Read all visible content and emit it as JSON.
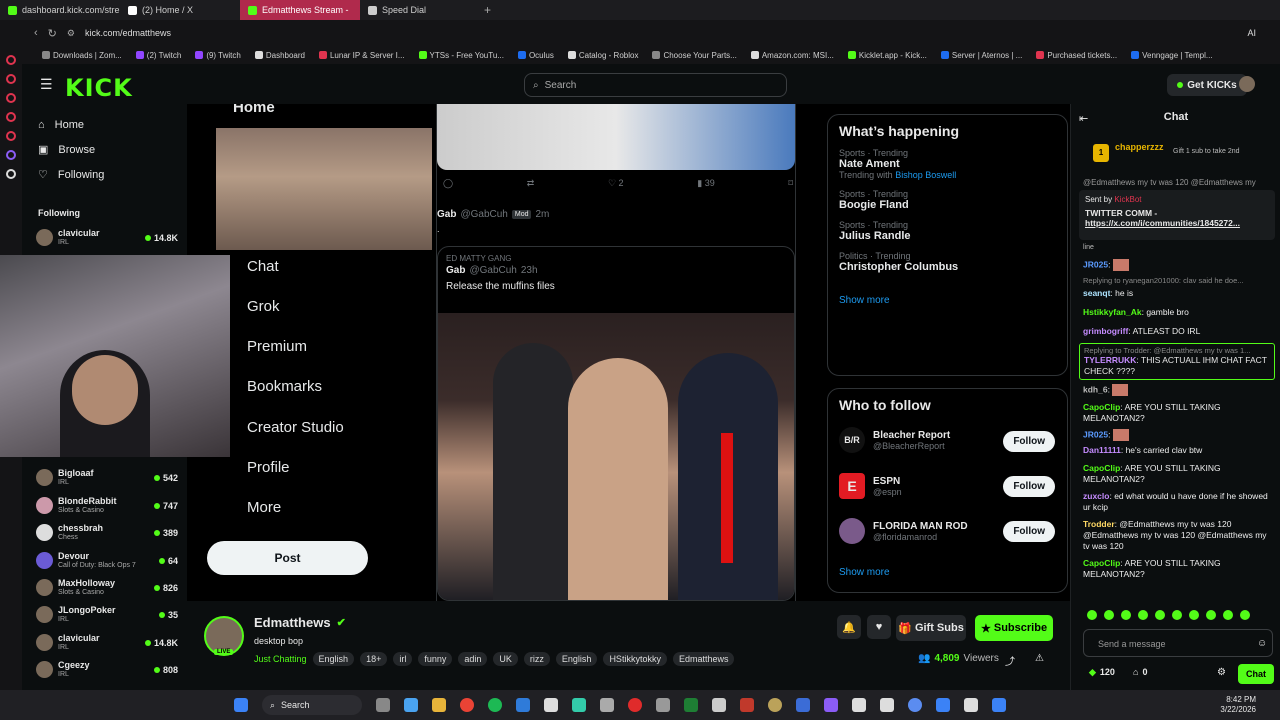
{
  "browser": {
    "tabs": [
      {
        "label": "dashboard.kick.com/stre",
        "color": "#53fc18",
        "active": false
      },
      {
        "label": "(2) Home / X",
        "color": "#ffffff",
        "active": false
      },
      {
        "label": "Edmatthews Stream -",
        "color": "#53fc18",
        "active": true
      },
      {
        "label": "Speed Dial",
        "color": "#cccccc",
        "active": false
      }
    ],
    "url": "kick.com/edmatthews",
    "bookmarks": [
      "Downloads | Zom...",
      "(2) Twitch",
      "(9) Twitch",
      "Dashboard",
      "Lunar IP & Server I...",
      "YTSs - Free YouTu...",
      "Oculus",
      "Catalog - Roblox",
      "Choose Your Parts...",
      "Amazon.com: MSI...",
      "Kicklet.app - Kick...",
      "Server | Aternos | ...",
      "Purchased tickets...",
      "Venngage | Templ..."
    ],
    "ai_label": "AI"
  },
  "header": {
    "logo": "KICK",
    "search_placeholder": "Search",
    "get_kicks": "Get KICKs"
  },
  "sidebar": {
    "nav": [
      {
        "label": "Home",
        "icon": "home-icon"
      },
      {
        "label": "Browse",
        "icon": "browse-icon"
      },
      {
        "label": "Following",
        "icon": "heart-icon"
      }
    ],
    "following_title": "Following",
    "following": [
      {
        "name": "clavicular",
        "category": "IRL",
        "count": "14.8K"
      },
      {
        "name": "Bigloaaf",
        "category": "IRL",
        "count": "542"
      },
      {
        "name": "BlondeRabbit",
        "category": "Slots & Casino",
        "count": "747"
      },
      {
        "name": "chessbrah",
        "category": "Chess",
        "count": "389"
      },
      {
        "name": "Devour",
        "category": "Call of Duty: Black Ops 7",
        "count": "64"
      },
      {
        "name": "MaxHolloway",
        "category": "Slots & Casino",
        "count": "826"
      },
      {
        "name": "JLongoPoker",
        "category": "IRL",
        "count": "35"
      },
      {
        "name": "clavicular",
        "category": "IRL",
        "count": "14.8K"
      },
      {
        "name": "Cgeezy",
        "category": "IRL",
        "count": "808"
      }
    ]
  },
  "stream_content": {
    "x_nav": [
      "Home",
      "Chat",
      "Grok",
      "Premium",
      "Bookmarks",
      "Creator Studio",
      "Profile",
      "More"
    ],
    "post_button": "Post",
    "tweet_stats": {
      "likes": "2",
      "views": "39"
    },
    "tweet": {
      "author": "Gab",
      "handle": "@GabCuh",
      "badge": "Mod",
      "time": "2m",
      "dot": "."
    },
    "quoted": {
      "community": "ED MATTY GANG",
      "author": "Gab",
      "handle": "@GabCuh",
      "time": "23h",
      "text": "Release the muffins files"
    },
    "whats_happening": {
      "title": "What’s happening",
      "trends": [
        {
          "meta": "Sports · Trending",
          "title": "Nate Ament",
          "extra_prefix": "Trending with",
          "extra_link": "Bishop Boswell"
        },
        {
          "meta": "Sports · Trending",
          "title": "Boogie Fland"
        },
        {
          "meta": "Sports · Trending",
          "title": "Julius Randle"
        },
        {
          "meta": "Politics · Trending",
          "title": "Christopher Columbus"
        }
      ],
      "show_more": "Show more"
    },
    "who_to_follow": {
      "title": "Who to follow",
      "accounts": [
        {
          "name": "Bleacher Report",
          "handle": "@BleacherReport",
          "logo": "B/R",
          "logo_bg": "#111111"
        },
        {
          "name": "ESPN",
          "handle": "@espn",
          "logo": "E",
          "logo_bg": "#e21b23"
        },
        {
          "name": "FLORIDA MAN ROD",
          "handle": "@floridamanrod",
          "logo": "",
          "logo_bg": "#7a5a8a"
        }
      ],
      "follow_label": "Follow",
      "show_more": "Show more"
    }
  },
  "channel": {
    "name": "Edmatthews",
    "title": "desktop bop",
    "category": "Just Chatting",
    "tags": [
      "English",
      "18+",
      "irl",
      "funny",
      "adin",
      "UK",
      "rizz",
      "English",
      "HStikkytokky",
      "Edmatthews"
    ],
    "live_badge": "LIVE",
    "gift_subs": "Gift Subs",
    "subscribe": "Subscribe",
    "viewers": "4,809",
    "viewers_label": "Viewers"
  },
  "chat": {
    "title": "Chat",
    "pinned_user": "chapperzzz",
    "pinned_text": "Gift 1 sub to take 2nd",
    "pinned_count": "1",
    "pinned_msg": {
      "sender_label": "Sent by",
      "sender": "KickBot",
      "line1": "TWITTER COMM -",
      "line2": "https://x.com/i/communities/1845272..."
    },
    "clipped_text": "@Edmatthews my tv was 120 @Edmatthews my",
    "messages": [
      {
        "user": "",
        "text": "line",
        "color": "#bbbbbb"
      },
      {
        "user": "JR025",
        "text": "",
        "color": "#5b9bff",
        "emote": true
      },
      {
        "reply": "Replying to ryanegan201000: clav said he doe..."
      },
      {
        "user": "seanqt",
        "text": "he is",
        "color": "#aee4ff"
      },
      {
        "user": "Hstikkyfan_Ak",
        "text": "gamble bro",
        "color": "#53fc18"
      },
      {
        "user": "grimbogriff",
        "text": "ATLEAST DO IRL",
        "color": "#c58cff"
      },
      {
        "reply": "Replying to Trodder: @Edmatthews my tv was 1..."
      },
      {
        "user": "TYLERRUKK",
        "text": "THIS ACTUALL IHM CHAT FACT CHECK ????",
        "color": "#c58cff"
      },
      {
        "user": "kdh_6",
        "text": "",
        "color": "#bbbbbb",
        "emote": true
      },
      {
        "user": "CapoClip",
        "text": "ARE YOU STILL TAKING MELANOTAN2?",
        "color": "#53fc18"
      },
      {
        "user": "JR025",
        "text": "",
        "color": "#5b9bff",
        "emote": true
      },
      {
        "user": "Dan11111",
        "text": "he's carried clav btw",
        "color": "#c58cff"
      },
      {
        "user": "CapoClip",
        "text": "ARE YOU STILL TAKING MELANOTAN2?",
        "color": "#53fc18"
      },
      {
        "user": "zuxclo",
        "text": "ed what would u have done if he showed ur kcip",
        "color": "#c58cff"
      },
      {
        "user": "Trodder",
        "text": "@Edmatthews my tv was 120 @Edmatthews my tv was 120 @Edmatthews my tv was 120",
        "color": "#ffd966"
      },
      {
        "user": "CapoClip",
        "text": "ARE YOU STILL TAKING MELANOTAN2?",
        "color": "#53fc18"
      }
    ],
    "input_placeholder": "Send a message",
    "points": "120",
    "lock_count": "0",
    "send_label": "Chat"
  },
  "taskbar": {
    "search": "Search",
    "time": "8:42 PM",
    "date": "3/22/2026"
  },
  "colors": {
    "kick_green": "#53fc18",
    "opera_red": "#e0344f",
    "x_blue": "#1d9bf0"
  }
}
